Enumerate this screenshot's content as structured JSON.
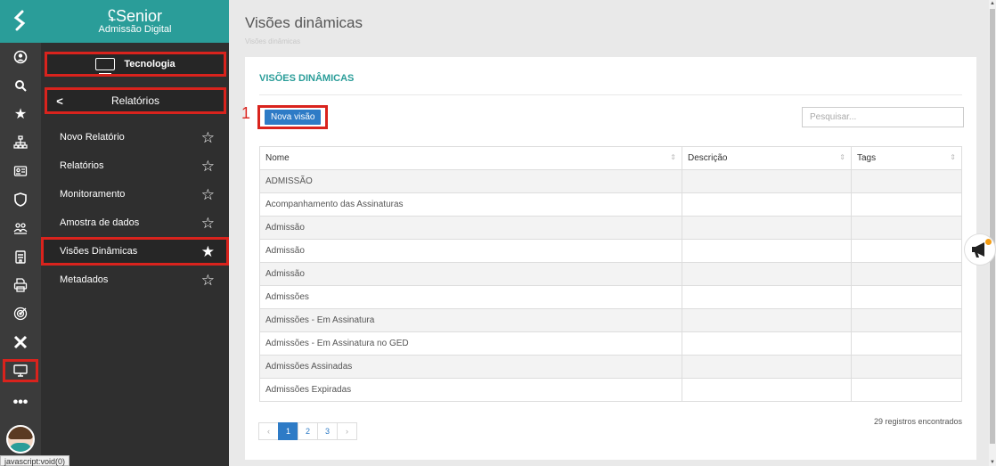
{
  "app": {
    "brand_name": "Senior",
    "brand_sub": "Admissão Digital",
    "status_text": "javascript:void(0)"
  },
  "rail": {
    "icons": [
      "user-circle-icon",
      "search-icon",
      "star-icon",
      "org-chart-icon",
      "id-badge-icon",
      "shield-icon",
      "people-icon",
      "building-icon",
      "printer-icon",
      "target-icon",
      "x-icon",
      "monitor-icon",
      "more-icon"
    ]
  },
  "sidebar": {
    "module_label": "Tecnologia",
    "section_label": "Relatórios",
    "items": [
      {
        "label": "Novo Relatório",
        "starred": false
      },
      {
        "label": "Relatórios",
        "starred": false
      },
      {
        "label": "Monitoramento",
        "starred": false
      },
      {
        "label": "Amostra de dados",
        "starred": false
      },
      {
        "label": "Visões Dinâmicas",
        "starred": true
      },
      {
        "label": "Metadados",
        "starred": false
      }
    ]
  },
  "main": {
    "title": "Visões dinâmicas",
    "breadcrumb": "Visões dinâmicas",
    "panel_heading": "VISÕES DINÂMICAS",
    "step_number": "1",
    "new_button": "Nova visão",
    "search_placeholder": "Pesquisar...",
    "table": {
      "columns": [
        "Nome",
        "Descrição",
        "Tags"
      ],
      "rows": [
        [
          "ADMISSÃO",
          "",
          ""
        ],
        [
          "Acompanhamento das Assinaturas",
          "",
          ""
        ],
        [
          "Admissão",
          "",
          ""
        ],
        [
          "Admissão",
          "",
          ""
        ],
        [
          "Admissão",
          "",
          ""
        ],
        [
          "Admissões",
          "",
          ""
        ],
        [
          "Admissões - Em Assinatura",
          "",
          ""
        ],
        [
          "Admissões - Em Assinatura no GED",
          "",
          ""
        ],
        [
          "Admissões Assinadas",
          "",
          ""
        ],
        [
          "Admissões Expiradas",
          "",
          ""
        ]
      ]
    },
    "records_count": "29 registros encontrados",
    "pagination": {
      "prev": "‹",
      "pages": [
        "1",
        "2",
        "3"
      ],
      "next": "›",
      "current": "1"
    }
  },
  "colors": {
    "brand": "#2a9d99",
    "highlight": "#d9231d",
    "primary": "#2e7bc6"
  }
}
